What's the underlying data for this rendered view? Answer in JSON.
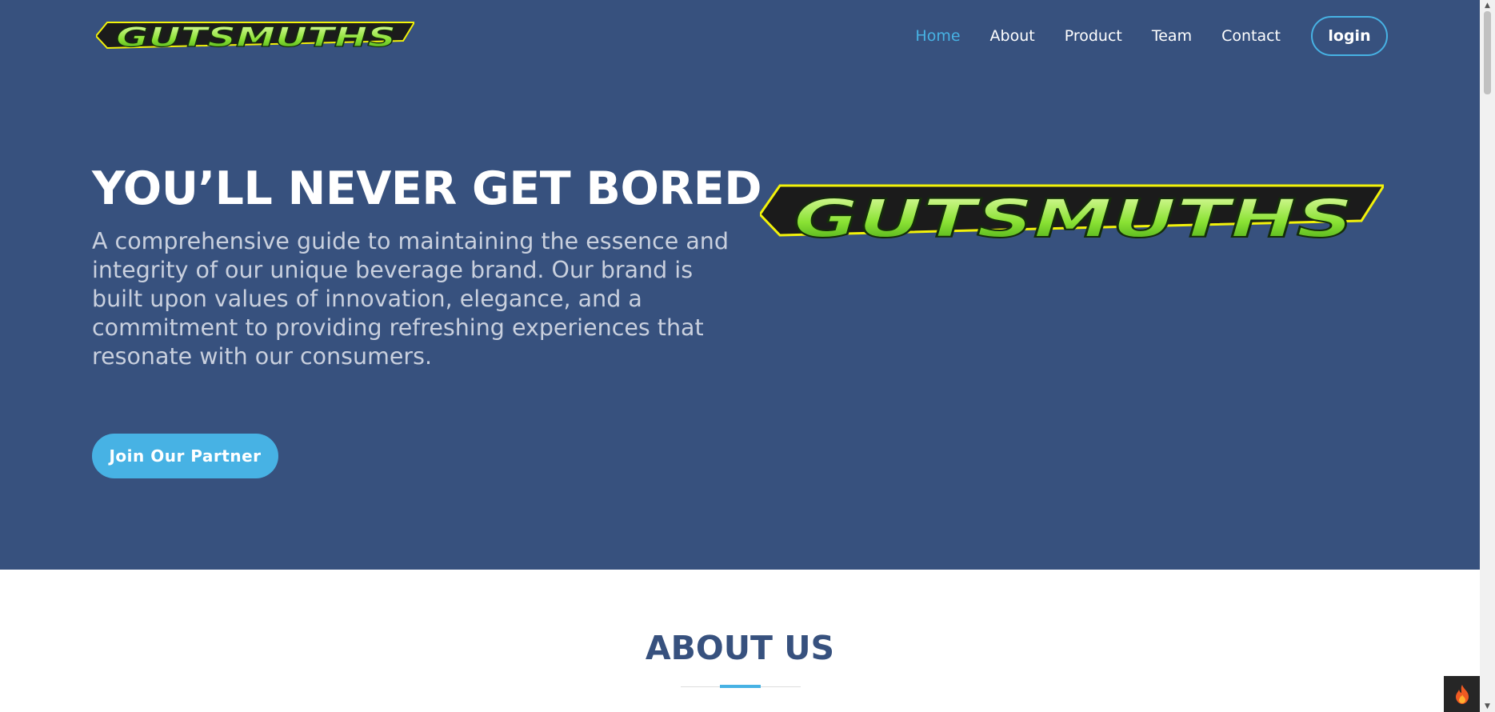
{
  "nav": {
    "items": [
      {
        "label": "Home",
        "active": true
      },
      {
        "label": "About",
        "active": false
      },
      {
        "label": "Product",
        "active": false
      },
      {
        "label": "Team",
        "active": false
      },
      {
        "label": "Contact",
        "active": false
      }
    ],
    "login_label": "login"
  },
  "brand": {
    "logo_text": "GUTSMUTHS",
    "logo_icon": "gutsmuths-logo"
  },
  "hero": {
    "title": "YOU’LL NEVER GET BORED",
    "description": "A comprehensive guide to maintaining the essence and integrity of our unique beverage brand. Our brand is built upon values of innovation, elegance, and a commitment to providing refreshing experiences that resonate with our consumers.",
    "cta_label": "Join Our Partner"
  },
  "about": {
    "title": "ABOUT US"
  },
  "widgets": {
    "fire_icon": "flame-icon"
  },
  "colors": {
    "hero_bg": "#37517e",
    "accent": "#47b2e4",
    "hero_text_muted": "#c9d0de",
    "logo_green": "#8ae234",
    "logo_outline": "#f2f20a"
  }
}
